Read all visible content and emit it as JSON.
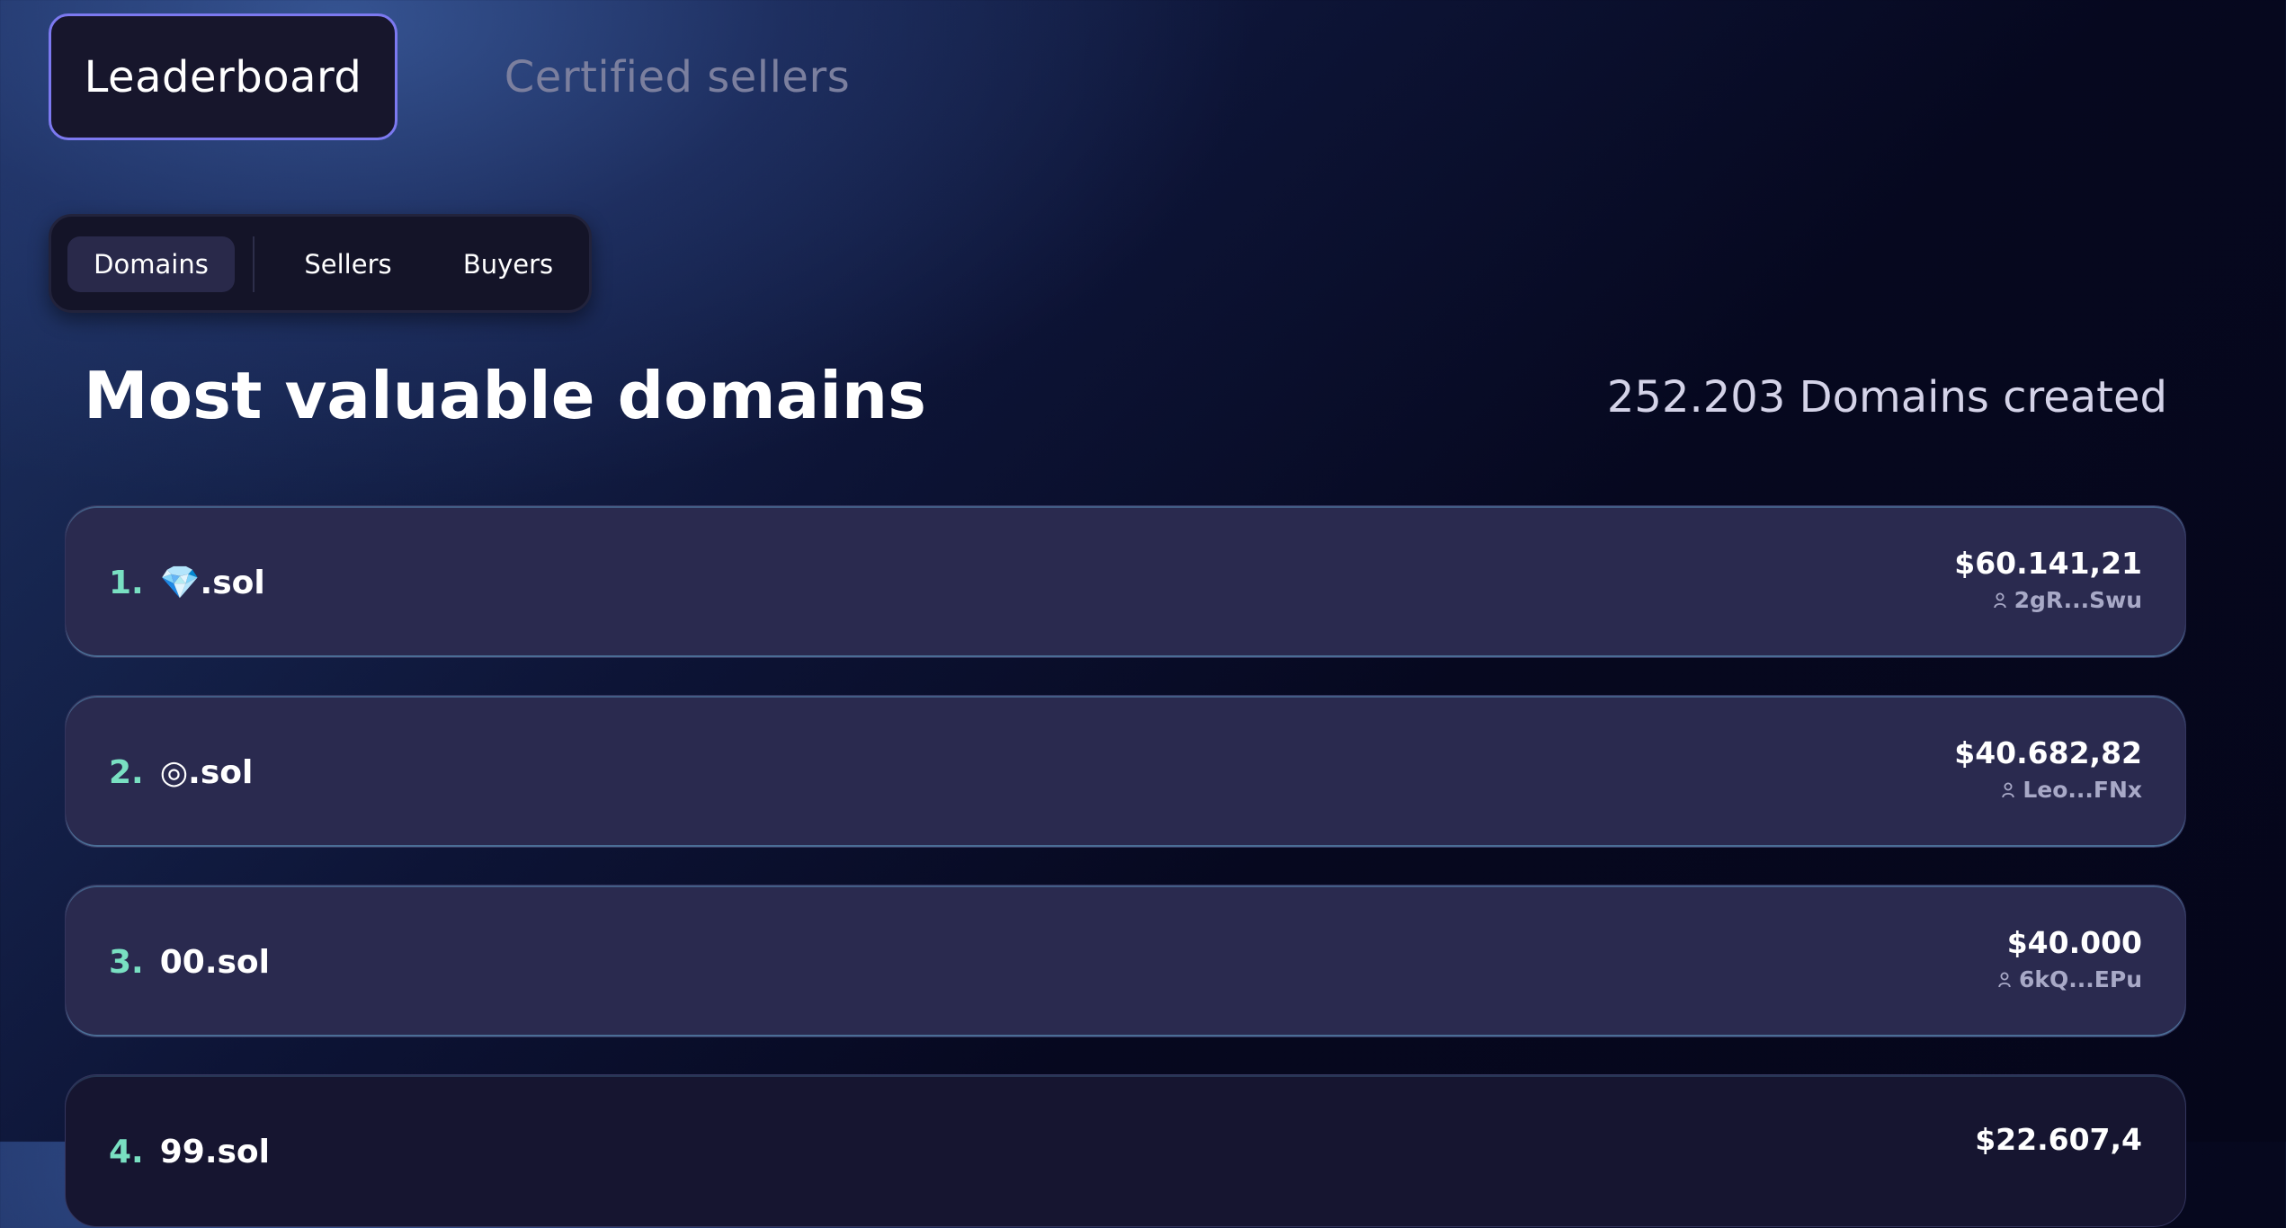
{
  "top_tabs": [
    {
      "label": "Leaderboard",
      "active": true
    },
    {
      "label": "Certified sellers",
      "active": false
    }
  ],
  "segmented": {
    "options": [
      "Domains",
      "Sellers",
      "Buyers"
    ],
    "selected": "Domains"
  },
  "heading": {
    "title": "Most valuable domains",
    "count_text": "252.203 Domains created"
  },
  "domains": [
    {
      "rank": "1.",
      "name": "💎.sol",
      "price": "$60.141,21",
      "owner": "2gR...Swu"
    },
    {
      "rank": "2.",
      "name": "◎.sol",
      "price": "$40.682,82",
      "owner": "Leo...FNx"
    },
    {
      "rank": "3.",
      "name": "00.sol",
      "price": "$40.000",
      "owner": "6kQ...EPu"
    },
    {
      "rank": "4.",
      "name": "99.sol",
      "price": "$22.607,4",
      "owner": ""
    }
  ],
  "colors": {
    "accent_border": "#7c79f0",
    "rank": "#79e0c2",
    "row_bg": "#2a2a4f"
  },
  "icons": {
    "owner": "user-icon"
  }
}
